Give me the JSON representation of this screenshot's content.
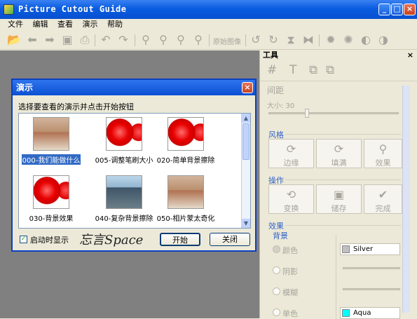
{
  "window": {
    "title": "Picture Cutout Guide"
  },
  "window_buttons": {
    "minimize": "_",
    "maximize": "□",
    "close": "×"
  },
  "menu": [
    "文件",
    "编辑",
    "查看",
    "演示",
    "帮助"
  ],
  "toolbar": {
    "original_image_label": "原始图像"
  },
  "panel": {
    "title": "工具",
    "close": "×",
    "spacing_title": "间距",
    "size_label": "大小: 30",
    "style_title": "风格",
    "style_buttons": [
      "边缘",
      "填满",
      "效果"
    ],
    "operation_title": "操作",
    "operation_buttons": [
      "变换",
      "储存",
      "完成"
    ],
    "effects_title": "效果",
    "background_title": "背景",
    "bg_options": [
      "颜色",
      "阴影",
      "模糊",
      "单色"
    ],
    "color_silver": "Silver",
    "color_aqua": "Aqua",
    "colors": {
      "silver": "#c0c0c0",
      "aqua": "#00ffff"
    }
  },
  "dialog": {
    "title": "演示",
    "close": "×",
    "instruction": "选择要查看的演示并点击开始按钮",
    "items": [
      {
        "label": "000-我们能做什么",
        "thumb": "room"
      },
      {
        "label": "005-调整笔刷大小",
        "thumb": "red"
      },
      {
        "label": "020-简单背景擦除",
        "thumb": "red"
      },
      {
        "label": "030-背景效果",
        "thumb": "red"
      },
      {
        "label": "040-复杂背景擦除",
        "thumb": "people"
      },
      {
        "label": "050-相片蒙太奇化",
        "thumb": "room"
      }
    ],
    "startup_checkbox": "启动时显示",
    "logo_text": "忘言Space",
    "start_button": "开始",
    "close_button": "关闭"
  }
}
